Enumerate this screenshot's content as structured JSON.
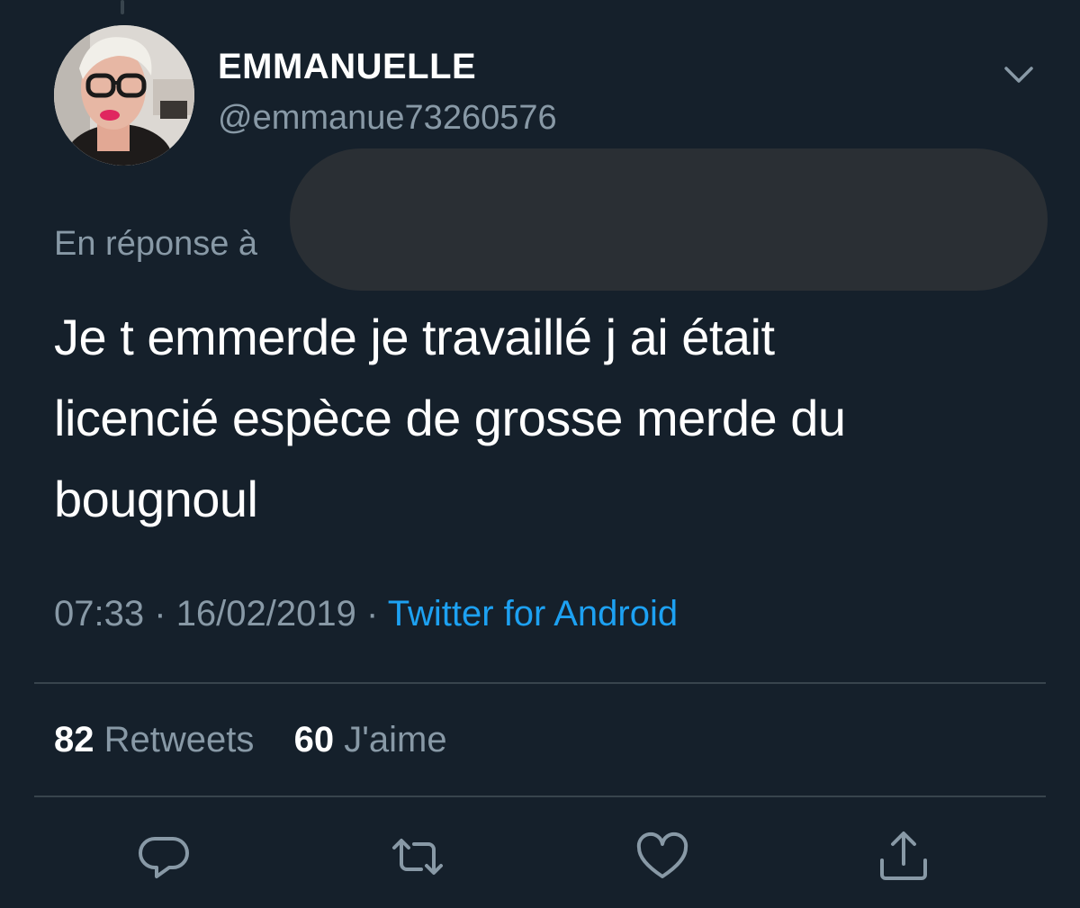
{
  "tweet": {
    "author": {
      "display_name": "EMMANUELLE",
      "handle": "@emmanue73260576"
    },
    "reply_to_label": "En réponse à",
    "text": "Je t emmerde je travaillé j ai était\nlicencié espèce de grosse merde du\nbougnoul",
    "time": "07:33",
    "separator": "·",
    "date": "16/02/2019",
    "source": "Twitter for Android",
    "stats": {
      "retweets_count": "82",
      "retweets_label": "Retweets",
      "likes_count": "60",
      "likes_label": "J'aime"
    }
  },
  "icons": {
    "menu": "chevron-down-icon",
    "reply": "reply-icon",
    "retweet": "retweet-icon",
    "like": "heart-icon",
    "share": "share-icon"
  },
  "colors": {
    "background": "#15202b",
    "secondary_text": "#8899a6",
    "link": "#1da1f2",
    "divider": "#38444d",
    "redaction": "#2a2f34"
  }
}
